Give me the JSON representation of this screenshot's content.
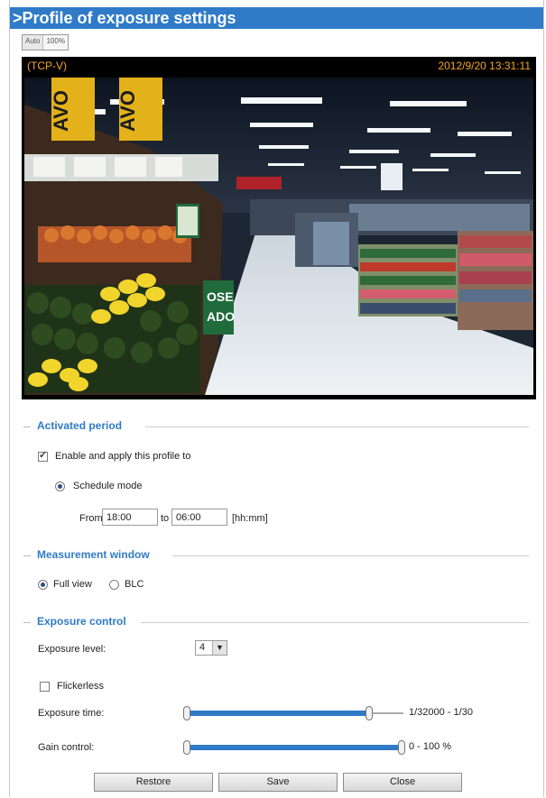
{
  "page": {
    "title": ">Profile of exposure settings"
  },
  "view_toggle": {
    "auto_label": "Auto",
    "percent_label": "100%"
  },
  "video": {
    "stream_label": "(TCP-V)",
    "timestamp": "2012/9/20 13:31:11"
  },
  "activated_period": {
    "heading": "Activated period",
    "enable_label": "Enable and apply this profile to",
    "enable_checked": true,
    "schedule_label": "Schedule mode",
    "schedule_selected": true,
    "from_label": "From",
    "from_value": "18:00",
    "to_label": "to",
    "to_value": "06:00",
    "format_hint": "[hh:mm]"
  },
  "measurement_window": {
    "heading": "Measurement window",
    "options": [
      "Full view",
      "BLC"
    ],
    "selected": "Full view"
  },
  "exposure_control": {
    "heading": "Exposure control",
    "level_label": "Exposure level:",
    "level_value": "4",
    "flickerless_label": "Flickerless",
    "flickerless_checked": false,
    "time_label": "Exposure time:",
    "time_range": "1/32000 - 1/30",
    "time_fill_fraction": 0.85,
    "gain_label": "Gain control:",
    "gain_range": "0 - 100 %",
    "gain_fill_fraction": 1.0
  },
  "buttons": {
    "restore": "Restore",
    "save": "Save",
    "close": "Close"
  },
  "colors": {
    "accent": "#2f7bc7",
    "timestamp": "#f5a623"
  }
}
